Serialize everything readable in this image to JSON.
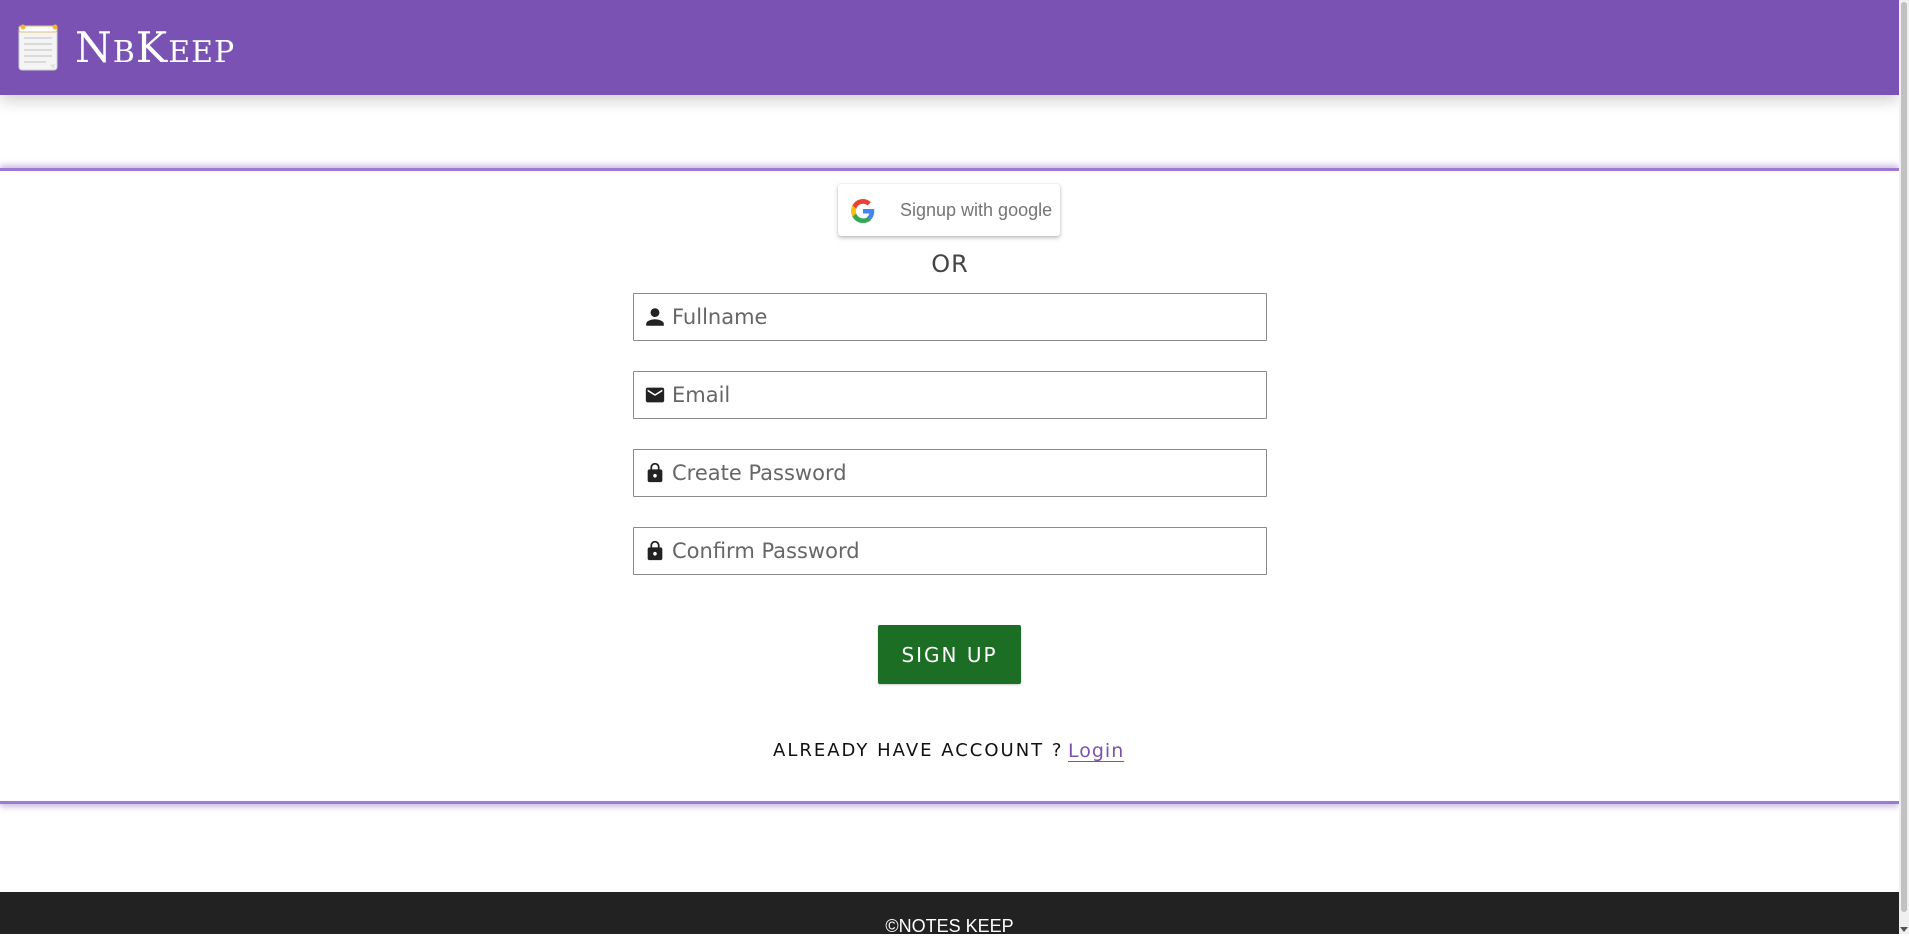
{
  "header": {
    "brand_initial": "N",
    "brand_rest": "b",
    "brand_initial2": "K",
    "brand_rest2": "eep",
    "color": "#7a52b3"
  },
  "google": {
    "label": "Signup with google",
    "icon": "google-g-icon"
  },
  "divider_text": "OR",
  "form": {
    "fullname": {
      "placeholder": "Fullname",
      "value": "",
      "icon": "person-icon"
    },
    "email": {
      "placeholder": "Email",
      "value": "",
      "icon": "mail-icon"
    },
    "create_password": {
      "placeholder": "Create Password",
      "value": "",
      "icon": "lock-icon"
    },
    "confirm_password": {
      "placeholder": "Confirm Password",
      "value": "",
      "icon": "lock-icon"
    },
    "submit_label": "SIGN UP",
    "submit_color": "#1b6e23"
  },
  "account": {
    "question": "ALREADY HAVE ACCOUNT ?",
    "login_label": "Login"
  },
  "footer": {
    "copyright": "©NOTES KEEP",
    "color": "#222222"
  }
}
